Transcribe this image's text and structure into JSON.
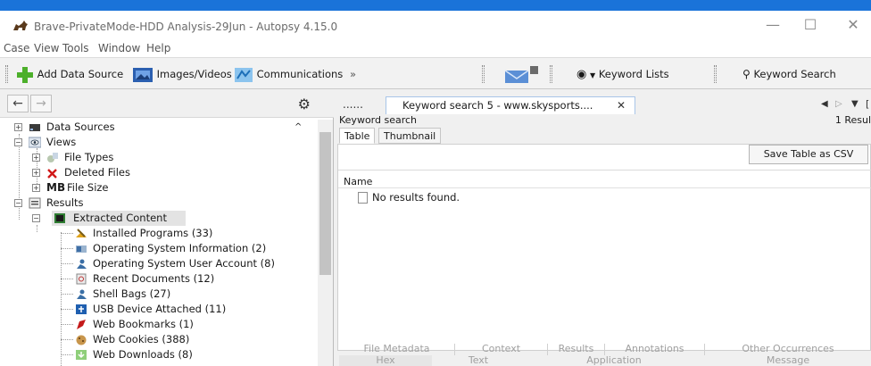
{
  "window": {
    "title": "Brave-PrivateMode-HDD Analysis-29Jun - Autopsy 4.15.0",
    "min_glyph": "—",
    "max_glyph": "☐",
    "close_glyph": "✕"
  },
  "menu": [
    "Case",
    "View",
    "Tools",
    "Window",
    "Help"
  ],
  "toolbar": {
    "add_data_source": "Add Data Source",
    "images_videos": "Images/Videos",
    "communications": "Communications",
    "comm_chevron": "»",
    "keyword_lists": "Keyword Lists",
    "keyword_search": "Keyword Search"
  },
  "nav": {
    "back": "←",
    "forward": "→",
    "gear": "⚙"
  },
  "tree": [
    {
      "label": "Data Sources",
      "icon": "drive-icon"
    },
    {
      "label": "Views",
      "icon": "eye-icon"
    },
    {
      "label": "File Types",
      "icon": "file-types-icon"
    },
    {
      "label": "Deleted Files",
      "icon": "deleted-files-icon"
    },
    {
      "label": "File Size",
      "prefix": "MB",
      "icon": ""
    },
    {
      "label": "Results",
      "icon": "results-icon"
    },
    {
      "label": "Extracted Content",
      "icon": "extracted-content-icon"
    },
    {
      "label": "Installed Programs (33)",
      "icon": "installed-programs-icon"
    },
    {
      "label": "Operating System Information (2)",
      "icon": "os-info-icon"
    },
    {
      "label": "Operating System User Account (8)",
      "icon": "user-account-icon"
    },
    {
      "label": "Recent Documents (12)",
      "icon": "recent-documents-icon"
    },
    {
      "label": "Shell Bags (27)",
      "icon": "shell-bags-icon"
    },
    {
      "label": "USB Device Attached (11)",
      "icon": "usb-icon"
    },
    {
      "label": "Web Bookmarks (1)",
      "icon": "bookmark-icon"
    },
    {
      "label": "Web Cookies (388)",
      "icon": "cookie-icon"
    },
    {
      "label": "Web Downloads (8)",
      "icon": "download-icon"
    }
  ],
  "tabs": {
    "prev_tab": "......",
    "active_tab": "Keyword search 5 - www.skysports....",
    "close": "✕",
    "nav_left": "◀",
    "nav_right": "▷",
    "nav_down": "▼",
    "nav_extra": "[",
    "keyword_search_label": "Keyword search",
    "result_count": "1 Resul"
  },
  "view_tabs": [
    "Table",
    "Thumbnail"
  ],
  "results": {
    "save_button": "Save Table as CSV",
    "column_name": "Name",
    "empty_message": "No results found."
  },
  "bottom_tabs": {
    "row1": [
      "File Metadata",
      "Context",
      "Results",
      "Annotations",
      "Other Occurrences"
    ],
    "row2": [
      "Hex",
      "Text",
      "Application",
      "Message"
    ]
  },
  "colors": {
    "accent": "#1a73d9",
    "extracted_green": "#2e7d32"
  }
}
